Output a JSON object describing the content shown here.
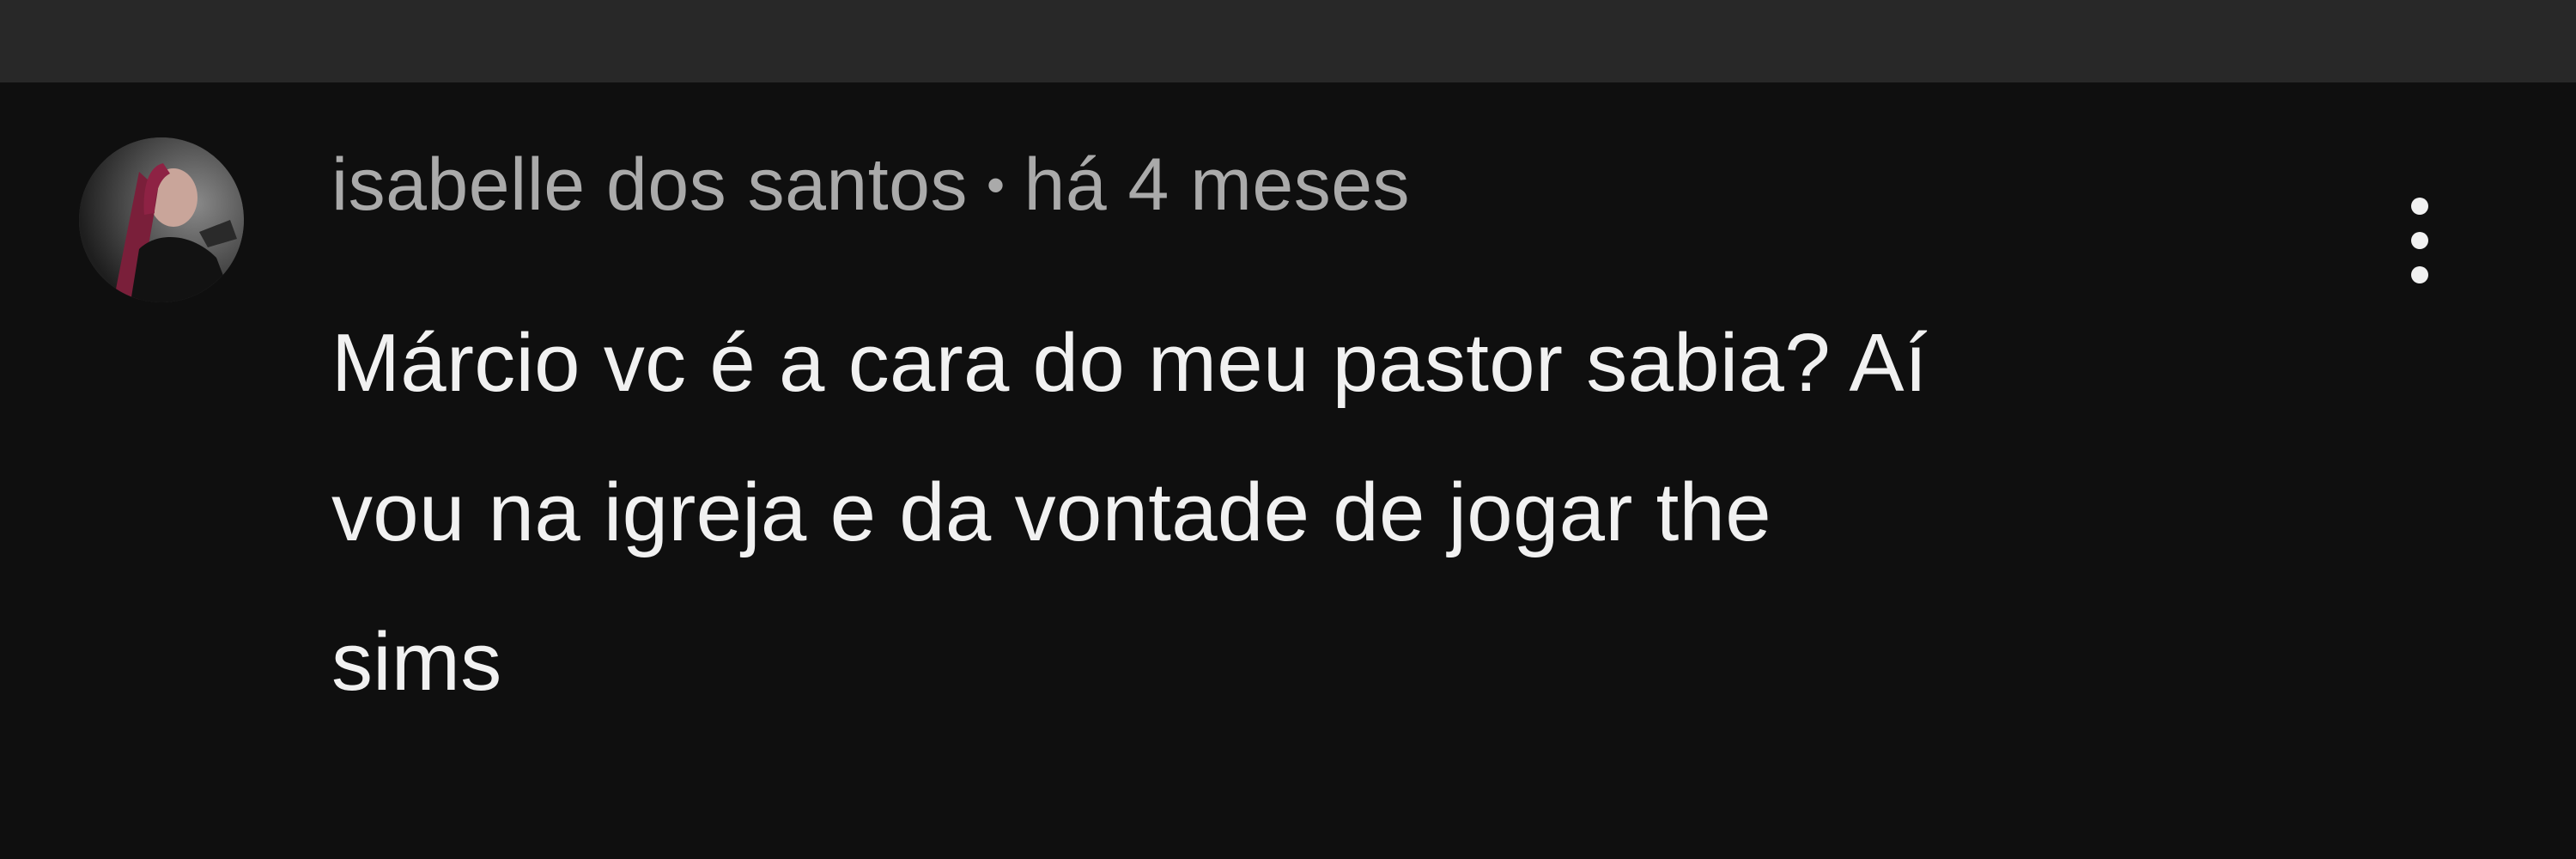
{
  "comment": {
    "author": "isabelle dos santos",
    "separator": "•",
    "time": "há 4 meses",
    "text_lines": [
      "Márcio vc é a cara do meu pastor sabia? Aí",
      "vou na igreja e da vontade de jogar the",
      "sims"
    ],
    "avatar": "user-avatar",
    "more_icon": "vertical-dots-icon"
  },
  "colors": {
    "background": "#0f0f0f",
    "top_bar": "#282828",
    "meta_text": "#aaaaaa",
    "comment_text": "#f1f1f1"
  }
}
